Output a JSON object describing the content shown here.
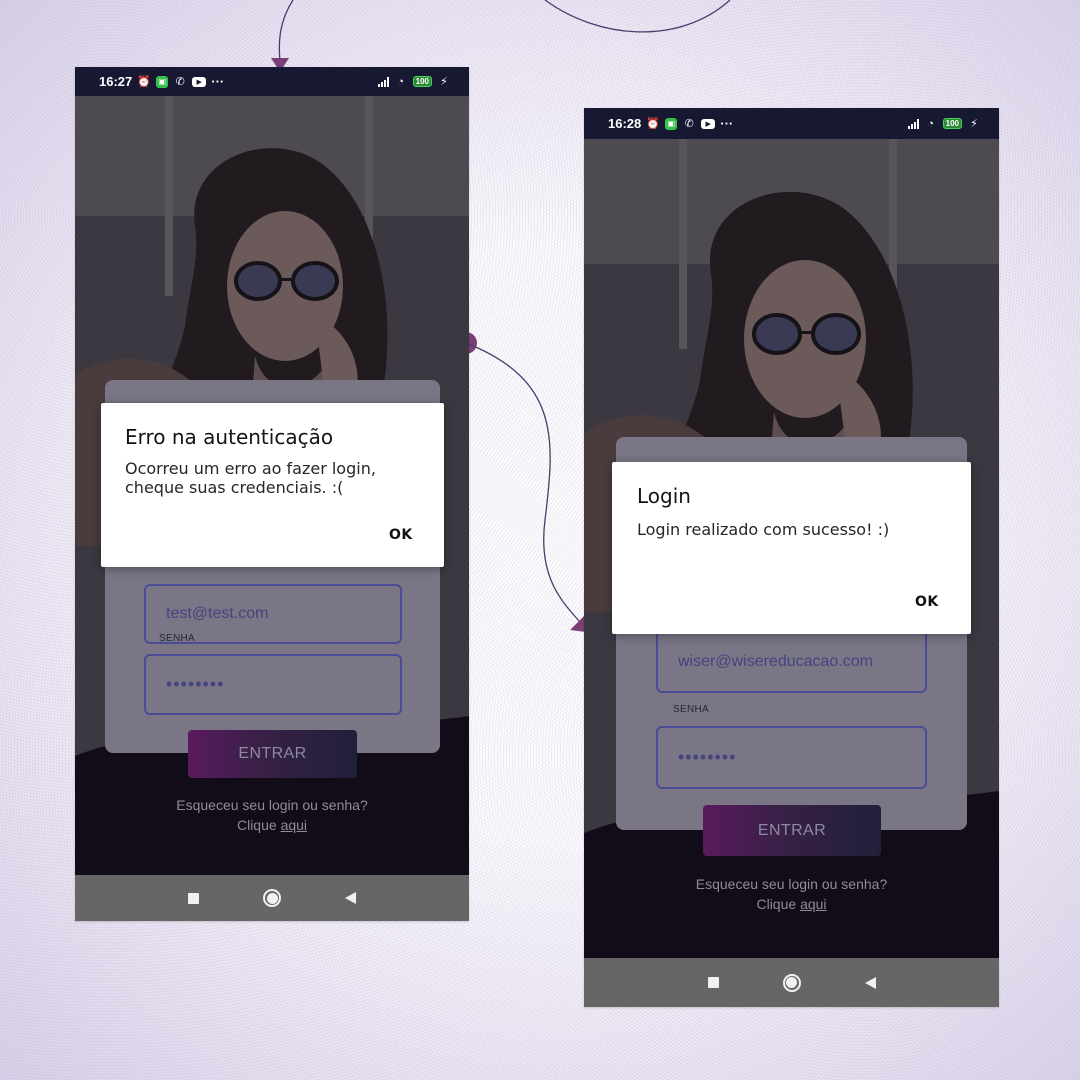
{
  "left_phone": {
    "status": {
      "time": "16:27",
      "more": "···",
      "battery": "100",
      "icons": [
        "alarm-icon",
        "app-icon",
        "whatsapp-icon",
        "youtube-icon",
        "signal-icon",
        "wifi-icon",
        "battery-icon",
        "charging-icon"
      ]
    },
    "login": {
      "email_value": "test@test.com",
      "password_label": "SENHA",
      "password_value": "••••••••",
      "enter_button": "ENTRAR",
      "forgot_line1": "Esqueceu seu login ou senha?",
      "forgot_click": "Clique",
      "forgot_link": "aqui"
    },
    "dialog": {
      "title": "Erro na autenticação",
      "message": "Ocorreu um erro ao fazer login, cheque suas credenciais. :(",
      "ok": "OK"
    }
  },
  "right_phone": {
    "status": {
      "time": "16:28",
      "more": "···",
      "battery": "100",
      "icons": [
        "alarm-icon",
        "app-icon",
        "whatsapp-icon",
        "youtube-icon",
        "signal-icon",
        "wifi-icon",
        "battery-icon",
        "charging-icon"
      ]
    },
    "login": {
      "email_value": "wiser@wisereducacao.com",
      "password_label": "SENHA",
      "password_value": "••••••••",
      "enter_button": "ENTRAR",
      "forgot_line1": "Esqueceu seu login ou senha?",
      "forgot_click": "Clique",
      "forgot_link": "aqui"
    },
    "dialog": {
      "title": "Login",
      "message": "Login realizado com sucesso! :)",
      "ok": "OK"
    }
  },
  "colors": {
    "connector": "#4a3d6a",
    "connector_dot": "#7a3f78",
    "status_bar": "#171831",
    "nav_bar": "#666666",
    "field_border": "#4b4c98"
  }
}
